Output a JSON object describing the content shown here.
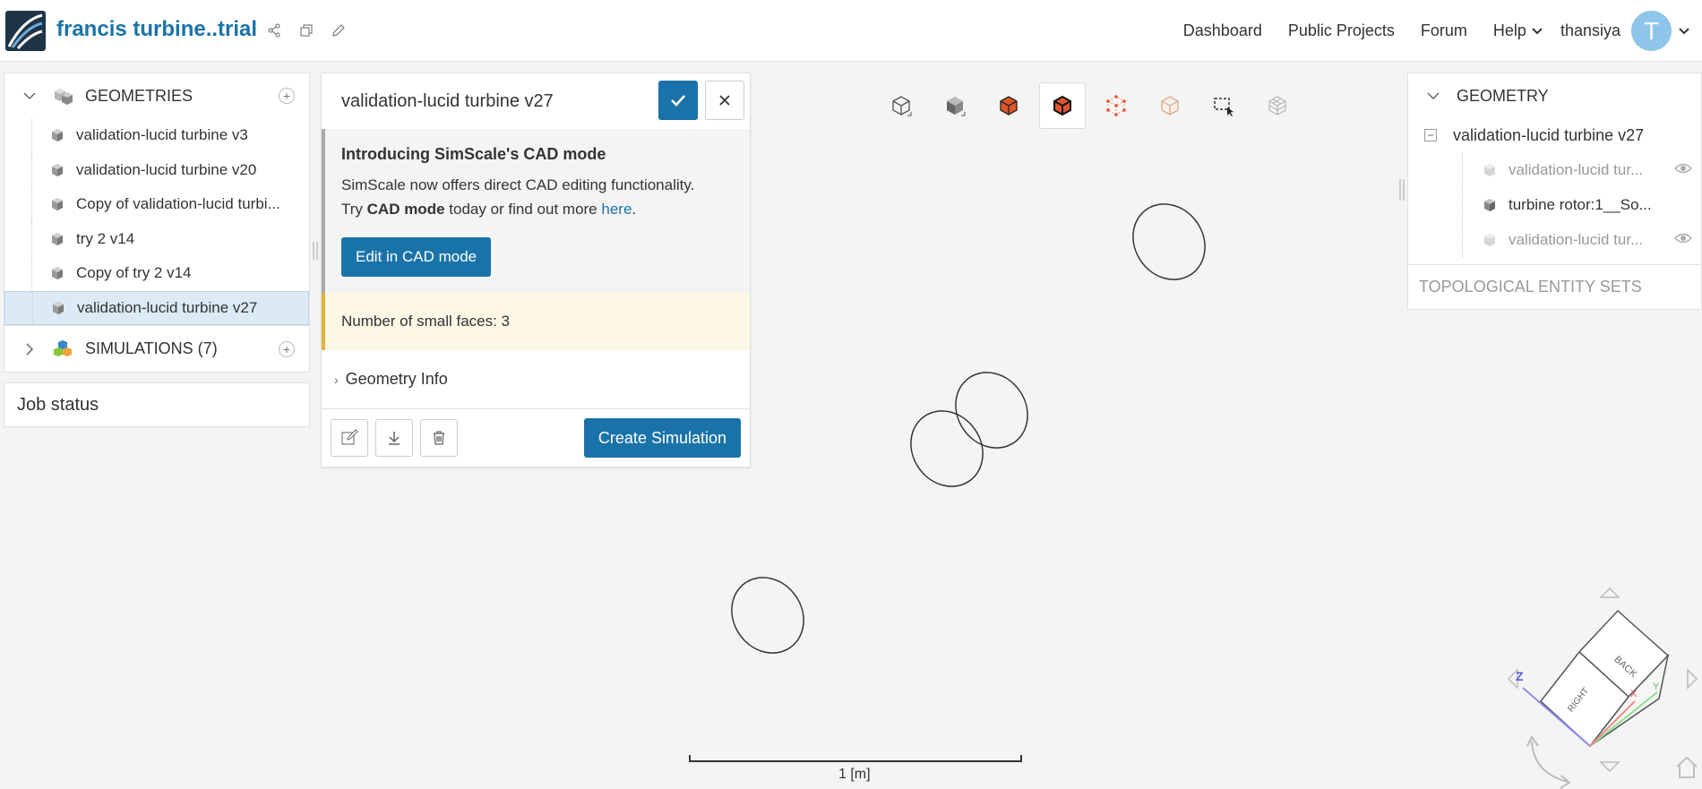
{
  "header": {
    "project_title": "francis turbine..trial",
    "nav": [
      "Dashboard",
      "Public Projects",
      "Forum"
    ],
    "help_label": "Help",
    "username": "thansiya",
    "avatar_letter": "T"
  },
  "left_panel": {
    "geometries_label": "GEOMETRIES",
    "geometries": [
      "validation-lucid turbine v3",
      "validation-lucid turbine v20",
      "Copy of validation-lucid turbi...",
      "try 2 v14",
      "Copy of try 2 v14",
      "validation-lucid turbine v27"
    ],
    "selected_index": 5,
    "simulations_label": "SIMULATIONS (7)",
    "job_status_label": "Job status"
  },
  "dialog": {
    "title": "validation-lucid turbine v27",
    "cad_title": "Introducing SimScale's CAD mode",
    "cad_line1": "SimScale now offers direct CAD editing functionality.",
    "cad_line2_pre": "Try ",
    "cad_line2_bold": "CAD mode",
    "cad_line2_mid": " today or find out more ",
    "cad_line2_link": "here",
    "cad_line2_end": ".",
    "edit_cad_button": "Edit in CAD mode",
    "warning": "Number of small faces: 3",
    "geometry_info": "Geometry Info",
    "create_simulation": "Create Simulation"
  },
  "right_panel": {
    "header": "GEOMETRY",
    "root": "validation-lucid turbine v27",
    "items": [
      {
        "label": "validation-lucid tur...",
        "dim": true
      },
      {
        "label": "turbine rotor:1__So...",
        "dim": false
      },
      {
        "label": "validation-lucid tur...",
        "dim": true
      }
    ],
    "topological_label": "TOPOLOGICAL ENTITY SETS"
  },
  "viewer": {
    "scale_label": "1 [m]",
    "navcube_back": "BACK",
    "navcube_right": "RIGHT",
    "axis_z": "Z",
    "axis_x": "X",
    "axis_y": "Y"
  },
  "colors": {
    "accent": "#1a73a8",
    "warning_border": "#e0b53c",
    "selected_bg": "#dbeaf5",
    "orange": "#e0542a"
  }
}
